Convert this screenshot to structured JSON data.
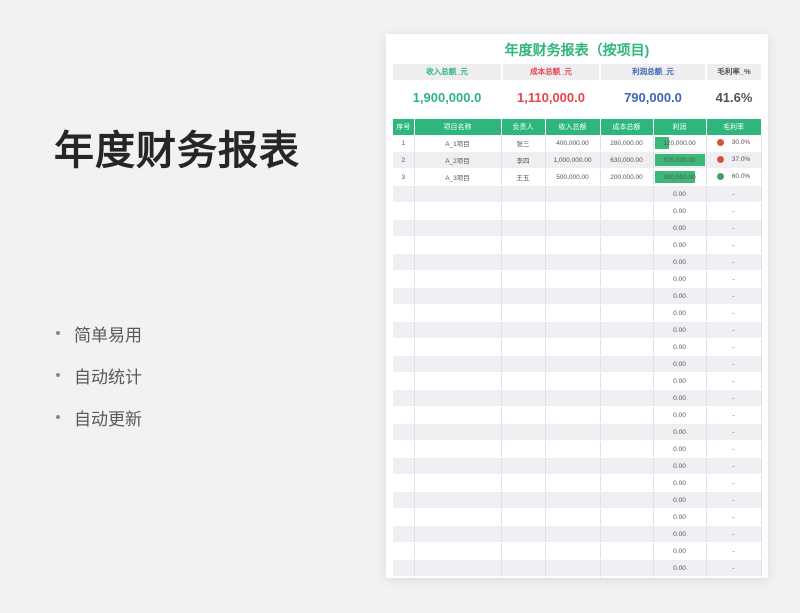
{
  "promo": {
    "title": "年度财务报表",
    "features": [
      "简单易用",
      "自动统计",
      "自动更新"
    ]
  },
  "sheet": {
    "title": "年度财务报表（按项目)",
    "kpis": [
      {
        "label": "收入总额_元",
        "value": "1,900,000.0",
        "color": "#2eb67d"
      },
      {
        "label": "成本总额_元",
        "value": "1,110,000.0",
        "color": "#e8434f"
      },
      {
        "label": "利润总额_元",
        "value": "790,000.0",
        "color": "#3d66b4"
      },
      {
        "label": "毛利率_%",
        "value": "41.6%",
        "color": "#555555"
      }
    ],
    "columns": [
      "序号",
      "项目名称",
      "负责人",
      "收入总额",
      "成本总额",
      "利润",
      "毛利率"
    ],
    "rows": [
      {
        "no": "1",
        "name": "A_1项目",
        "owner": "张三",
        "revenue": "400,000.00",
        "cost": "280,000.00",
        "profit": "120,000.00",
        "profit_fraction": 0.32,
        "margin": "30.0%",
        "margin_color": "#d4553a"
      },
      {
        "no": "2",
        "name": "A_2项目",
        "owner": "李四",
        "revenue": "1,000,000.00",
        "cost": "630,000.00",
        "profit": "370,000.00",
        "profit_fraction": 1.0,
        "margin": "37.0%",
        "margin_color": "#d4553a"
      },
      {
        "no": "3",
        "name": "A_3项目",
        "owner": "王五",
        "revenue": "500,000.00",
        "cost": "200,000.00",
        "profit": "300,000.00",
        "profit_fraction": 0.81,
        "margin": "60.0%",
        "margin_color": "#4a9a6f"
      }
    ],
    "empty_profit": "0.00",
    "empty_margin": "-"
  }
}
